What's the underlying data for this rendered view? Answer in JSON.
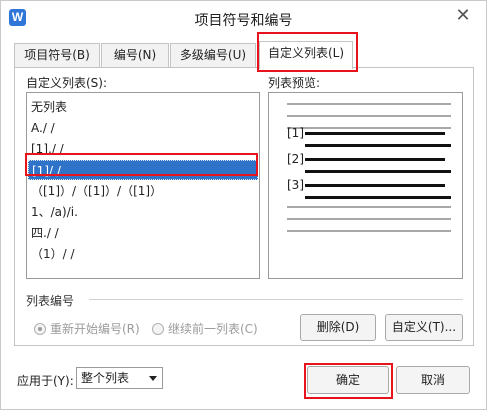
{
  "app": {
    "icon_letter": "W",
    "title": "项目符号和编号",
    "close_glyph": "✕"
  },
  "tabs": [
    {
      "label": "项目符号(B)"
    },
    {
      "label": "编号(N)"
    },
    {
      "label": "多级编号(U)"
    },
    {
      "label": "自定义列表(L)"
    }
  ],
  "custom_list": {
    "label": "自定义列表(S):",
    "items": [
      {
        "label": "无列表"
      },
      {
        "label": "A./ /"
      },
      {
        "label": "[1]./ /"
      },
      {
        "label": "[1]/ /"
      },
      {
        "label": "（[1]）/（[1]）/（[1]）"
      },
      {
        "label": "1、/a)/i."
      },
      {
        "label": "四./ /"
      },
      {
        "label": "（1）/ /"
      }
    ],
    "selected_index": 3
  },
  "preview": {
    "label": "列表预览:",
    "markers": [
      "[1]",
      "[2]",
      "[3]"
    ]
  },
  "numbering": {
    "group_label": "列表编号",
    "restart_label": "重新开始编号(R)",
    "continue_label": "继续前一列表(C)",
    "restart_checked": true
  },
  "buttons": {
    "delete_label": "删除(D)",
    "customize_label": "自定义(T)...",
    "ok_label": "确定",
    "cancel_label": "取消"
  },
  "apply_to": {
    "label": "应用于(Y):",
    "value": "整个列表"
  },
  "colors": {
    "accent": "#2f73c8",
    "highlight_box": "#e8141b"
  }
}
